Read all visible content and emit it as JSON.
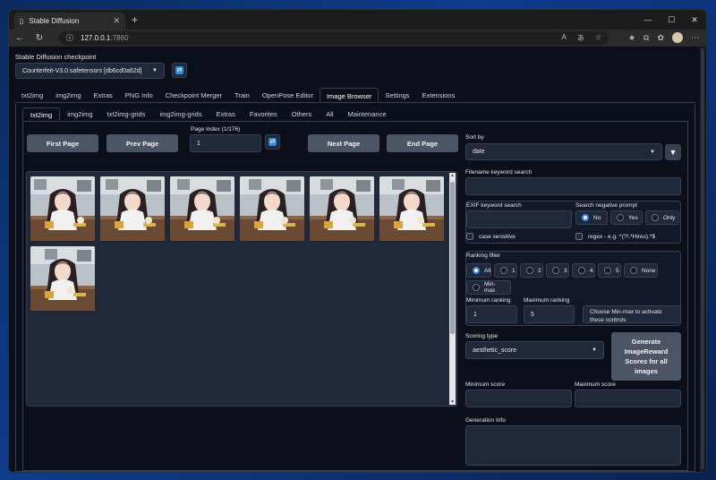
{
  "browser": {
    "tab_title": "Stable Diffusion",
    "url_host": "127.0.0.1",
    "url_port": ":7860"
  },
  "checkpoint": {
    "label": "Stable Diffusion checkpoint",
    "value": "Counterfeit-V3.0.safetensors [db6cd0a62d]"
  },
  "main_tabs": [
    "txt2img",
    "img2img",
    "Extras",
    "PNG Info",
    "Checkpoint Merger",
    "Train",
    "OpenPose Editor",
    "Image Browser",
    "Settings",
    "Extensions"
  ],
  "main_tab_active": 7,
  "sub_tabs": [
    "txt2img",
    "img2img",
    "txt2img-grids",
    "img2img-grids",
    "Extras",
    "Favorites",
    "Others",
    "All",
    "Maintenance"
  ],
  "sub_tab_active": 0,
  "paging": {
    "first": "First Page",
    "prev": "Prev Page",
    "index_label": "Page Index (1/176)",
    "index_value": "1",
    "next": "Next Page",
    "end": "End Page"
  },
  "gallery_count": 7,
  "sort": {
    "label": "Sort by",
    "value": "date"
  },
  "filename_search": {
    "label": "Filename keyword search",
    "value": ""
  },
  "exif_search": {
    "label": "EXIF keyword search",
    "value": ""
  },
  "negative_prompt": {
    "label": "Search negative prompt",
    "options": [
      "No",
      "Yes",
      "Only"
    ],
    "selected": 0
  },
  "case_sensitive": "case sensitive",
  "regex": "regex - e.g. ^(?!.*Hires).*$",
  "ranking": {
    "label": "Ranking filter",
    "options": [
      "All",
      "1",
      "2",
      "3",
      "4",
      "5",
      "None",
      "Min-max"
    ],
    "selected": 0,
    "min_label": "Minimum ranking",
    "min_value": "1",
    "max_label": "Maximum ranking",
    "max_value": "5",
    "hint": "Choose Min-max to activate these controls"
  },
  "scoring": {
    "label": "Scoring type",
    "value": "aesthetic_score",
    "generate_button": "Generate ImageReward Scores for all images",
    "min_label": "Minimum score",
    "max_label": "Maximum score"
  },
  "generation_info": {
    "label": "Generation Info"
  },
  "colors": {
    "bg": "#0b0f19",
    "panel": "#1f2937",
    "button": "#4b5563",
    "accent": "#3b82f6"
  }
}
